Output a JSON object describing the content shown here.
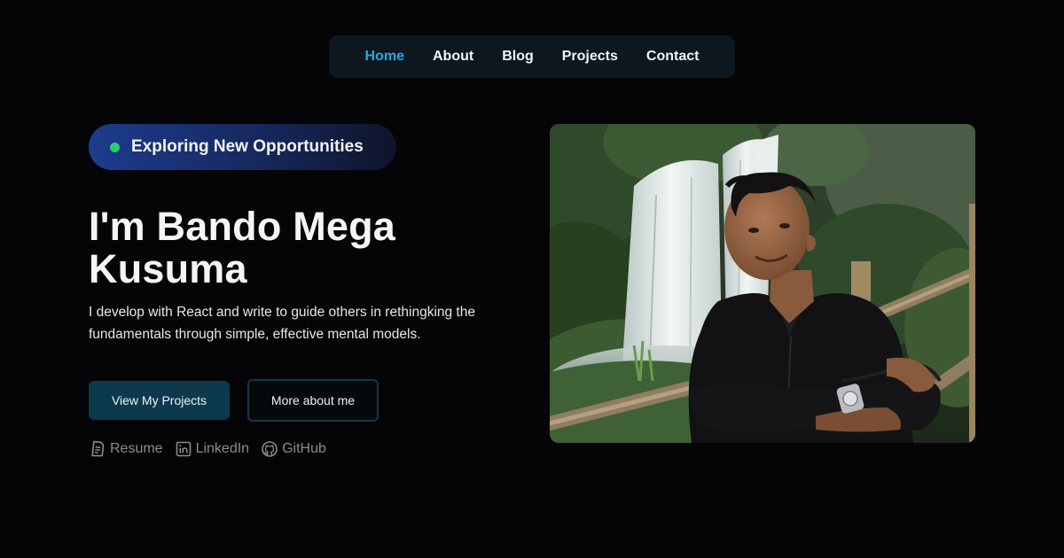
{
  "nav": {
    "items": [
      {
        "label": "Home",
        "active": true
      },
      {
        "label": "About",
        "active": false
      },
      {
        "label": "Blog",
        "active": false
      },
      {
        "label": "Projects",
        "active": false
      },
      {
        "label": "Contact",
        "active": false
      }
    ]
  },
  "hero": {
    "status_label": "Exploring New Opportunities",
    "status_color": "#2bd16b",
    "title_line1": "I'm Bando Mega",
    "title_line2": "Kusuma",
    "description_line1": "I develop with React and write to guide others in rethingking the",
    "description_line2": "fundamentals through simple, effective mental models.",
    "primary_button": "View My Projects",
    "secondary_button": "More about me",
    "links": [
      {
        "label": "Resume",
        "icon": "document-icon"
      },
      {
        "label": "LinkedIn",
        "icon": "linkedin-icon"
      },
      {
        "label": "GitHub",
        "icon": "github-icon"
      }
    ]
  },
  "photo": {
    "subject": "portrait-in-front-of-waterfall"
  },
  "colors": {
    "background": "#050507",
    "accent": "#2aa7e0",
    "nav_bg": "#0c171f",
    "primary_button_bg": "#0c3a4c"
  }
}
